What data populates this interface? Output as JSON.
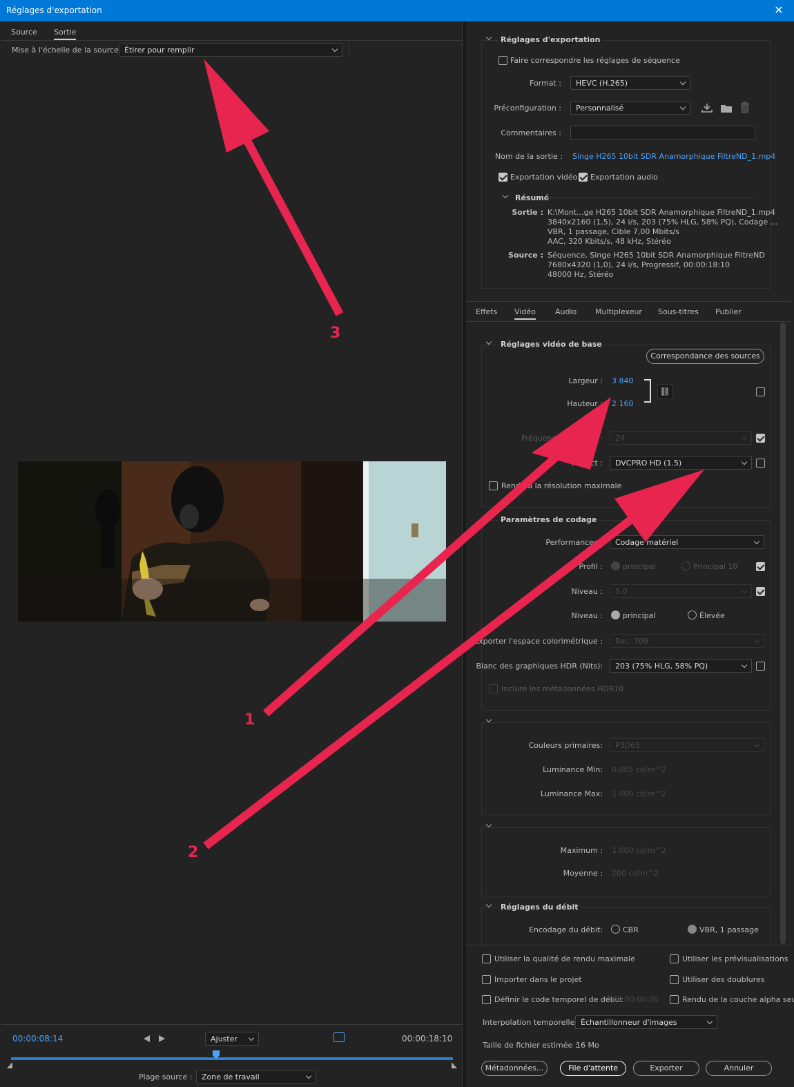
{
  "window": {
    "title": "Réglages d'exportation",
    "close_glyph": "✕"
  },
  "left_tabs": {
    "source": "Source",
    "output": "Sortie"
  },
  "source_scaling": {
    "label": "Mise à l'échelle de la source :",
    "value": "Étirer pour remplir"
  },
  "annotations": {
    "n1": "1",
    "n2": "2",
    "n3": "3"
  },
  "timeline": {
    "current_time": "00:00:08:14",
    "fit": "Ajuster",
    "end_time": "00:00:18:10",
    "range_label": "Plage source :",
    "range_value": "Zone de travail"
  },
  "export_settings": {
    "header": "Réglages d'exportation",
    "match_sequence": "Faire correspondre les réglages de séquence",
    "format_label": "Format :",
    "format_value": "HEVC (H.265)",
    "preset_label": "Préconfiguration :",
    "preset_value": "Personnalisé",
    "comments_label": "Commentaires :",
    "output_name_label": "Nom de la sortie :",
    "output_name_value": "Singe H265 10bit SDR Anamorphique FiltreND_1.mp4",
    "export_video": "Exportation vidéo",
    "export_audio": "Exportation audio",
    "summary_header": "Résumé",
    "summary_output_label": "Sortie :",
    "summary_output_lines": [
      "K:\\Mont...ge H265 10bit SDR Anamorphique FiltreND_1.mp4",
      "3840x2160 (1,5), 24 i/s, 203 (75% HLG, 58% PQ), Codage ...",
      "VBR, 1 passage, Cible 7,00  Mbits/s",
      "AAC, 320  Kbits/s, 48  kHz, Stéréo"
    ],
    "summary_source_label": "Source :",
    "summary_source_lines": [
      "Séquence, Singe H265 10bit SDR Anamorphique FiltreND",
      "7680x4320 (1,0), 24  i/s, Progressif, 00:00:18:10",
      "48000 Hz, Stéréo"
    ]
  },
  "right_tabs": [
    "Effets",
    "Vidéo",
    "Audio",
    "Multiplexeur",
    "Sous-titres",
    "Publier"
  ],
  "video_basic": {
    "header": "Réglages vidéo de base",
    "match_button": "Correspondance des sources",
    "width_label": "Largeur :",
    "width_value": "3 840",
    "height_label": "Hauteur :",
    "height_value": "2 160",
    "framerate_label": "Fréquence d'images :",
    "framerate_value": "24",
    "aspect_label": "Aspect :",
    "aspect_value": "DVCPRO HD (1.5)",
    "max_res": "Rendu à la résolution maximale"
  },
  "encoding": {
    "header": "Paramètres de codage",
    "performance_label": "Performances :",
    "performance_value": "Codage matériel",
    "profile_label": "Profil :",
    "profile_main": "principal",
    "profile_main10": "Principal 10",
    "level_label": "Niveau :",
    "level_value": "5.0",
    "tier_label": "Niveau :",
    "tier_main": "principal",
    "tier_high": "Élevée",
    "colorspace_label": "Exporter l'espace colorimétrique :",
    "colorspace_value": "Rec. 709",
    "hdr_white_label": "Blanc des graphiques HDR (Nits):",
    "hdr_white_value": "203 (75% HLG, 58% PQ)",
    "hdr10_meta": "Inclure les métadonnées HDR10"
  },
  "mastering": {
    "primaries_label": "Couleurs primaires:",
    "primaries_value": "P3D65",
    "lum_min_label": "Luminance Min:",
    "lum_min_value": "0,005  cd/m^2",
    "lum_max_label": "Luminance Max:",
    "lum_max_value": "1 000  cd/m^2"
  },
  "content_light": {
    "max_label": "Maximum :",
    "max_value": "1 000  cd/m^2",
    "avg_label": "Moyenne :",
    "avg_value": "200  cd/m^2"
  },
  "bitrate": {
    "header": "Réglages du débit",
    "encoding_label": "Encodage du débit:",
    "cbr": "CBR",
    "vbr": "VBR, 1 passage"
  },
  "bottom": {
    "max_quality": "Utiliser la qualité de rendu maximale",
    "previews": "Utiliser les prévisualisations",
    "import_project": "Importer dans le projet",
    "proxies": "Utiliser des doublures",
    "set_timecode": "Définir le code temporel de début",
    "timecode_value": "00:00:00:00",
    "alpha_only": "Rendu de la couche alpha seule",
    "interp_label": "Interpolation temporelle :",
    "interp_value": "Échantillonneur d'images",
    "filesize_label": "Taille de fichier estimée :",
    "filesize_value": "16 Mo",
    "btn_metadata": "Métadonnées...",
    "btn_queue": "File d'attente",
    "btn_export": "Exporter",
    "btn_cancel": "Annuler"
  },
  "colors": {
    "accent": "#0078d7",
    "arrow": "#e8254f",
    "timecode": "#4aa3ff"
  }
}
